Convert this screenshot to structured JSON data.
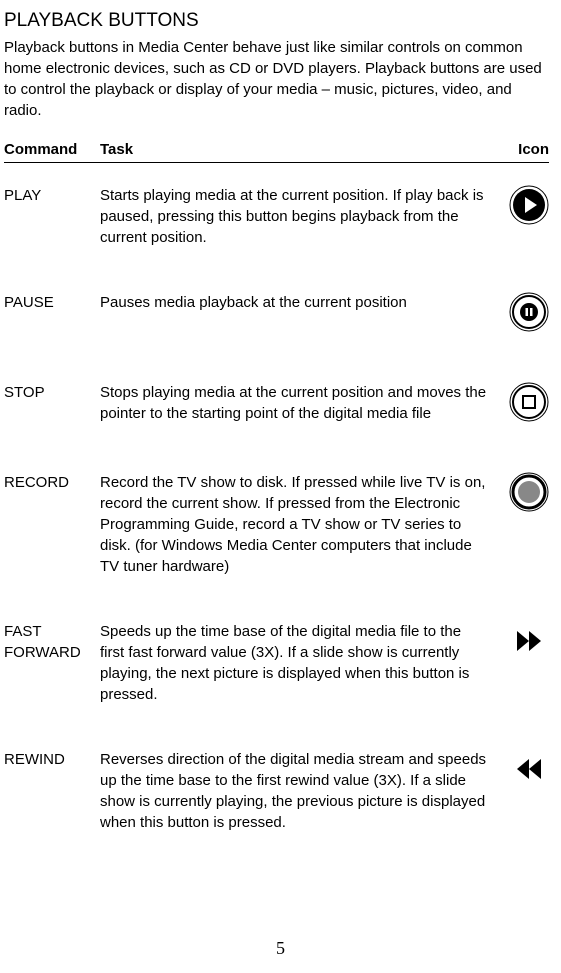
{
  "title": "PLAYBACK BUTTONS",
  "intro": "Playback buttons in Media Center behave just like similar controls on common home electronic devices, such as CD or DVD players. Playback buttons are used to control the playback or display of your media – music, pictures, video, and radio.",
  "headers": {
    "command": "Command",
    "task": "Task",
    "icon": "Icon"
  },
  "rows": [
    {
      "command": "PLAY",
      "task": "Starts playing media at the current position. If play back is paused, pressing this button begins playback from the current position.",
      "icon": "play-icon"
    },
    {
      "command": "PAUSE",
      "task": "Pauses media playback at the current position",
      "icon": "pause-icon"
    },
    {
      "command": "STOP",
      "task": "Stops playing media at the current position and moves the pointer to the starting point of the digital media file",
      "icon": "stop-icon"
    },
    {
      "command": "RECORD",
      "task": "Record the TV show to disk. If pressed while live TV is on, record the current show. If pressed from the Electronic Programming Guide, record a TV show or TV series to disk. (for Windows Media Center computers that include TV tuner hardware)",
      "icon": "record-icon"
    },
    {
      "command": "FAST FORWARD",
      "task": "Speeds up the time base of the digital media file to the first fast forward value (3X). If a slide show is currently playing, the next picture is displayed when this button is pressed.",
      "icon": "fast-forward-icon"
    },
    {
      "command": "REWIND",
      "task": "Reverses direction of the digital media stream and speeds up the time base to the first rewind value (3X). If a slide show is currently playing, the previous picture is displayed when this button is pressed.",
      "icon": "rewind-icon"
    }
  ],
  "page_number": "5"
}
